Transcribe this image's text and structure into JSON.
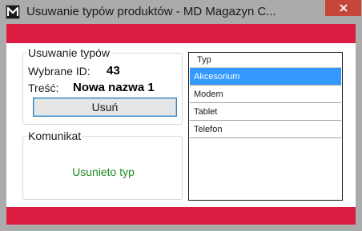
{
  "window": {
    "title": "Usuwanie typów produktów - MD Magazyn C...",
    "icon": "app-logo-m-icon",
    "close_icon": "close-icon",
    "accent_color": "#dc1c40",
    "close_color": "#c7463a"
  },
  "delete_group": {
    "legend": "Usuwanie typów",
    "id_label": "Wybrane ID:",
    "id_value": "43",
    "content_label": "Treść:",
    "content_value": "Nowa nazwa 1",
    "delete_button": "Usuń"
  },
  "message_group": {
    "legend": "Komunikat",
    "message": "Usunieto typ",
    "message_color": "#1e8a1e"
  },
  "types_grid": {
    "header": "Typ",
    "rows": [
      "Akcesorium",
      "Modem",
      "Tablet",
      "Telefon"
    ],
    "selected_index": 0,
    "selected_color": "#3399ff"
  }
}
